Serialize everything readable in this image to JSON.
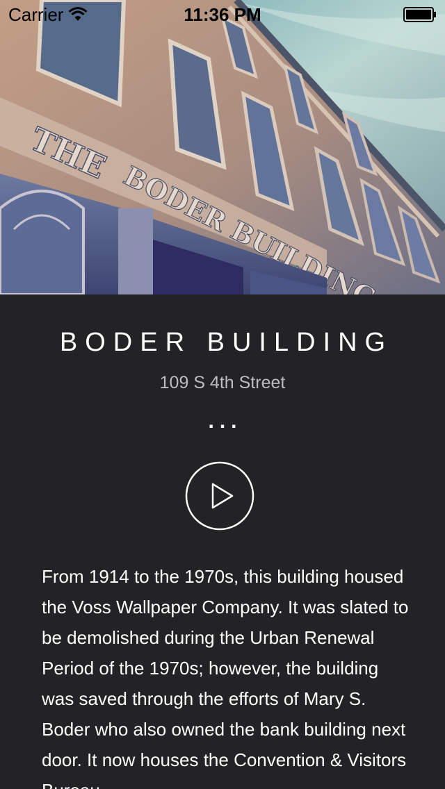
{
  "status_bar": {
    "carrier": "Carrier",
    "time": "11:36 PM",
    "wifi_icon": "wifi-icon",
    "battery_icon": "battery-icon"
  },
  "hero": {
    "sign_line_1": "THE",
    "sign_line_2": "BODER BUILDING"
  },
  "location": {
    "title": "BODER BUILDING",
    "address": "109 S 4th Street",
    "ellipsis": "...",
    "play_icon": "play-icon",
    "description": "From 1914 to the 1970s, this building housed the Voss Wallpaper Company. It was slated to be demolished during the Urban Renewal Period of the 1970s; however, the building was saved through the efforts of Mary S. Boder who also owned the bank building next door. It now houses the Convention & Visitors Bureau."
  },
  "colors": {
    "background": "#232325",
    "text": "#ffffff",
    "subtle_text": "#bdbdbf",
    "sky": "#8fb9bd",
    "brick": "#b7957f"
  }
}
